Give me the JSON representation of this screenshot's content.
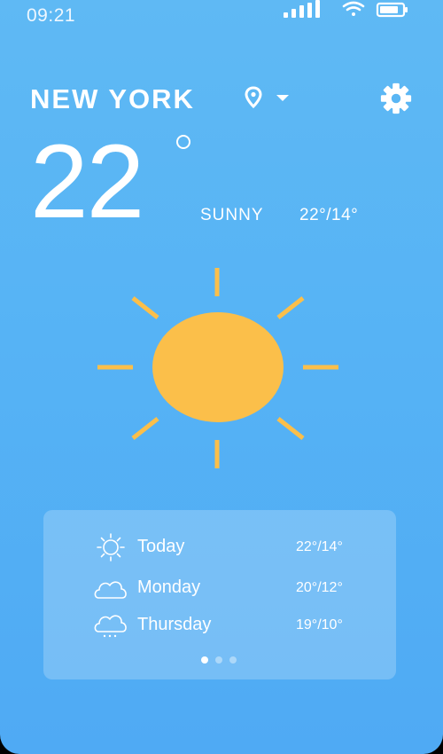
{
  "status_bar": {
    "time": "09:21",
    "icons": [
      "signal-icon",
      "wifi-icon",
      "battery-icon"
    ]
  },
  "header": {
    "city": "NEW YORK",
    "location_icon": "location-pin-icon",
    "dropdown_icon": "chevron-down-icon",
    "settings_icon": "gear-icon"
  },
  "current": {
    "temperature": "22",
    "condition": "SUNNY",
    "range": "22°/14°",
    "icon": "sun-icon"
  },
  "forecast": [
    {
      "day": "Today",
      "range": "22°/14°",
      "icon": "sun-icon"
    },
    {
      "day": "Monday",
      "range": "20°/12°",
      "icon": "cloud-icon"
    },
    {
      "day": "Thursday",
      "range": "19°/10°",
      "icon": "rain-cloud-icon"
    }
  ],
  "pagination": {
    "pages": 3,
    "active": 1
  },
  "colors": {
    "background_top": "#5fb9f4",
    "background_bottom": "#4faaf4",
    "sun": "#fbbf4a",
    "text": "#ffffff"
  }
}
